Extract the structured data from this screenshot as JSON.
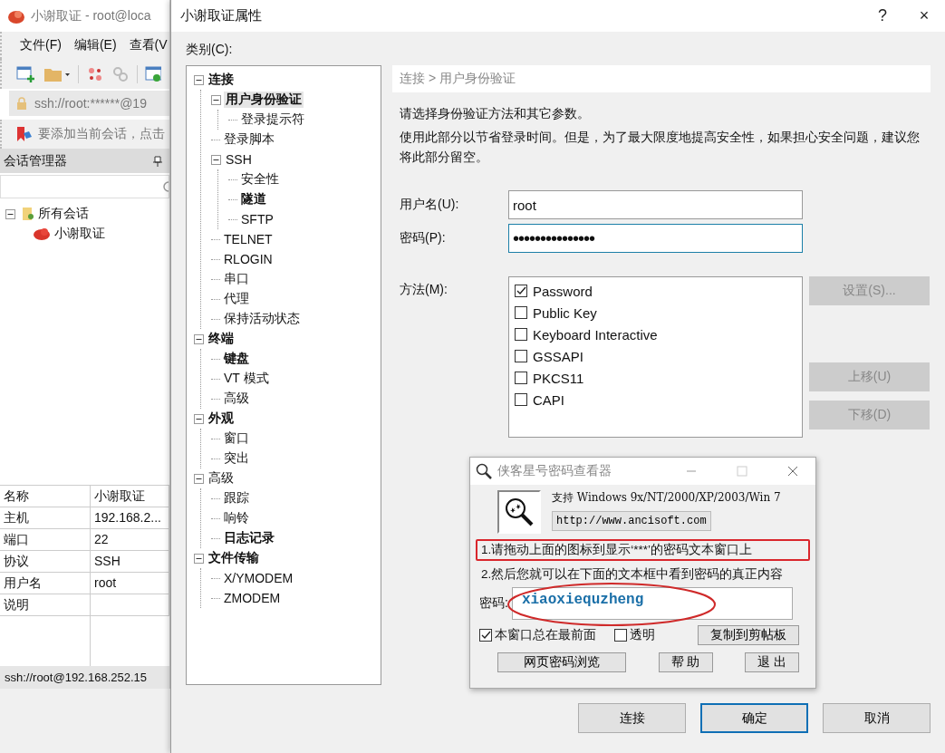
{
  "main_window": {
    "title": "小谢取证 - root@loca",
    "menu": [
      "文件(F)",
      "编辑(E)",
      "查看(V"
    ],
    "address": "ssh://root:******@19",
    "notice": "要添加当前会话，点击",
    "session_manager": {
      "title": "会话管理器",
      "tree": [
        {
          "label": "所有会话",
          "expanded": true,
          "children": [
            {
              "label": "小谢取证"
            }
          ]
        }
      ]
    },
    "properties": [
      {
        "name": "名称",
        "value": "小谢取证"
      },
      {
        "name": "主机",
        "value": "192.168.2..."
      },
      {
        "name": "端口",
        "value": "22"
      },
      {
        "name": "协议",
        "value": "SSH"
      },
      {
        "name": "用户名",
        "value": "root"
      },
      {
        "name": "说明"
      }
    ],
    "status_bar": "ssh://root@192.168.252.15"
  },
  "dialog": {
    "title": "小谢取证属性",
    "help": "?",
    "close": "×",
    "category_label": "类别(C):",
    "tree": [
      {
        "label": "连接",
        "bold": true,
        "selected": false,
        "expanded": true,
        "children": [
          {
            "label": "用户身份验证",
            "bold": true,
            "selected": true,
            "expanded": true,
            "children": [
              {
                "label": "登录提示符",
                "bold": false,
                "selected": false
              }
            ]
          },
          {
            "label": "登录脚本",
            "bold": false,
            "selected": false
          },
          {
            "label": "SSH",
            "bold": false,
            "selected": false,
            "expanded": true,
            "children": [
              {
                "label": "安全性",
                "bold": false,
                "selected": false
              },
              {
                "label": "隧道",
                "bold": true,
                "selected": false
              },
              {
                "label": "SFTP",
                "bold": false,
                "selected": false
              }
            ]
          },
          {
            "label": "TELNET",
            "bold": false,
            "selected": false
          },
          {
            "label": "RLOGIN",
            "bold": false,
            "selected": false
          },
          {
            "label": "串口",
            "bold": false,
            "selected": false
          },
          {
            "label": "代理",
            "bold": false,
            "selected": false
          },
          {
            "label": "保持活动状态",
            "bold": false,
            "selected": false
          }
        ]
      },
      {
        "label": "终端",
        "bold": true,
        "selected": false,
        "expanded": true,
        "children": [
          {
            "label": "键盘",
            "bold": true,
            "selected": false
          },
          {
            "label": "VT 模式",
            "bold": false,
            "selected": false
          },
          {
            "label": "高级",
            "bold": false,
            "selected": false
          }
        ]
      },
      {
        "label": "外观",
        "bold": true,
        "selected": false,
        "expanded": true,
        "children": [
          {
            "label": "窗口",
            "bold": false,
            "selected": false
          },
          {
            "label": "突出",
            "bold": false,
            "selected": false
          }
        ]
      },
      {
        "label": "高级",
        "bold": false,
        "selected": false,
        "expanded": true,
        "children": [
          {
            "label": "跟踪",
            "bold": false,
            "selected": false
          },
          {
            "label": "响铃",
            "bold": false,
            "selected": false
          },
          {
            "label": "日志记录",
            "bold": true,
            "selected": false
          }
        ]
      },
      {
        "label": "文件传输",
        "bold": true,
        "selected": false,
        "expanded": true,
        "children": [
          {
            "label": "X/YMODEM",
            "bold": false,
            "selected": false
          },
          {
            "label": "ZMODEM",
            "bold": false,
            "selected": false
          }
        ]
      }
    ],
    "breadcrumb": "连接 > 用户身份验证",
    "intro": "请选择身份验证方法和其它参数。",
    "note": "使用此部分以节省登录时间。但是，为了最大限度地提高安全性，如果担心安全问题，建议您将此部分留空。",
    "fields": [
      {
        "label": "用户名(U):",
        "value": "root",
        "kind": "text",
        "focused": false
      },
      {
        "label": "密码(P):",
        "value": "•••••••••••••••",
        "kind": "password",
        "focused": true
      }
    ],
    "method_label": "方法(M):",
    "methods": [
      {
        "label": "Password",
        "checked": true
      },
      {
        "label": "Public Key",
        "checked": false
      },
      {
        "label": "Keyboard Interactive",
        "checked": false
      },
      {
        "label": "GSSAPI",
        "checked": false
      },
      {
        "label": "PKCS11",
        "checked": false
      },
      {
        "label": "CAPI",
        "checked": false
      }
    ],
    "side_buttons": [
      {
        "label": "设置(S)...",
        "disabled": true
      },
      {
        "label": "上移(U)",
        "disabled": true
      },
      {
        "label": "下移(D)",
        "disabled": true
      }
    ],
    "buttons": [
      {
        "label": "连接",
        "default": false
      },
      {
        "label": "确定",
        "default": true
      },
      {
        "label": "取消",
        "default": false
      }
    ]
  },
  "viewer": {
    "title": "侠客星号密码查看器",
    "support": "支持 Windows 9x/NT/2000/XP/2003/Win 7",
    "url": "http://www.ancisoft.com",
    "steps": [
      {
        "text": "1.请拖动上面的图标到显示‘***’的密码文本窗口上",
        "highlighted": true
      },
      {
        "text": "2.然后您就可以在下面的文本框中看到密码的真正内容",
        "highlighted": false
      }
    ],
    "password_label": "密码:",
    "password": "xiaoxiequzheng",
    "circled": true,
    "options": [
      {
        "label": "本窗口总在最前面",
        "checked": true
      },
      {
        "label": "透明",
        "checked": false
      }
    ],
    "copy_button": "复制到剪帖板",
    "buttons": [
      "网页密码浏览",
      "帮 助",
      "退 出"
    ]
  }
}
